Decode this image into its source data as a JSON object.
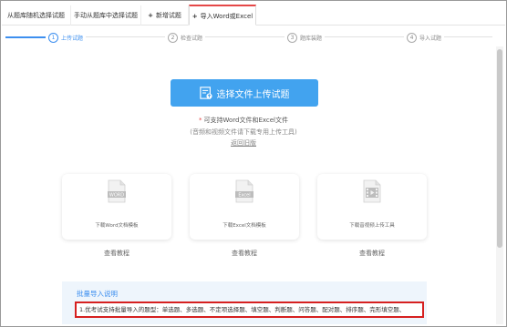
{
  "tabs": [
    {
      "label": "从题库随机选择试题",
      "plus": false,
      "active": false
    },
    {
      "label": "手动从题库中选择试题",
      "plus": false,
      "active": false
    },
    {
      "label": "新增试题",
      "plus": true,
      "active": false
    },
    {
      "label": "导入Word或Excel",
      "plus": true,
      "active": true
    }
  ],
  "steps": [
    {
      "num": "1",
      "label": "上传试题"
    },
    {
      "num": "2",
      "label": "检查试题"
    },
    {
      "num": "3",
      "label": "题库装题"
    },
    {
      "num": "4",
      "label": "导入试题"
    }
  ],
  "upload": {
    "button_label": "选择文件上传试题",
    "support_text": "可支持Word文件和Excel文件",
    "hint_text": "(音频和视频文件请下载专用上传工具)",
    "back_link": "返回旧版"
  },
  "cards": [
    {
      "badge": "WORD",
      "caption": "下载Word文档模板",
      "link": "查看教程"
    },
    {
      "badge": "Excel",
      "caption": "下载Excel文档模板",
      "link": "查看教程"
    },
    {
      "badge": "",
      "caption": "下载音视频上传工具",
      "link": "查看教程"
    }
  ],
  "notice": {
    "title": "批量导入说明",
    "line1": "1.优考试支持批量导入的题型：单选题、多选题、不定项选择题、填空题、判断题、问答题、配对题、排序题、完形填空题、"
  },
  "colors": {
    "accent": "#3d8fef",
    "button": "#42a3ef",
    "tab_active": "#e54848",
    "highlight_border": "#d62020"
  }
}
